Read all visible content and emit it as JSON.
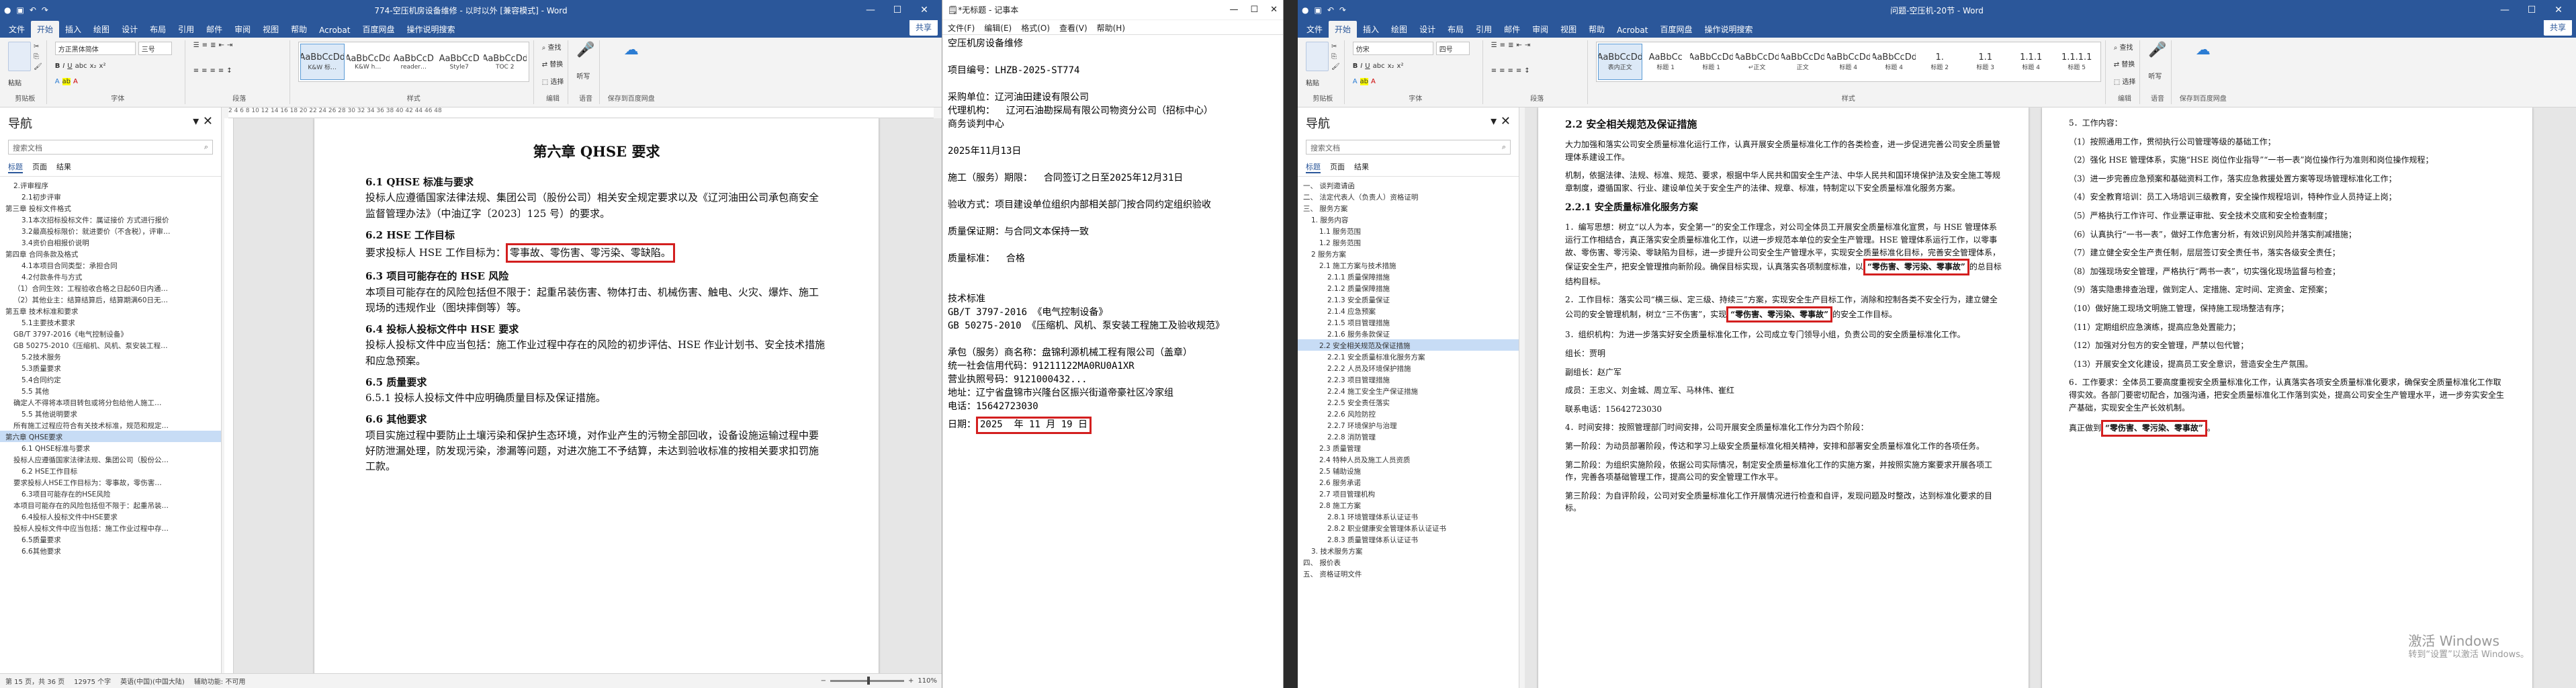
{
  "left": {
    "title": "774-空压机房设备维修 - 以时以外 [兼容模式] - Word",
    "tabs": [
      "文件",
      "开始",
      "插入",
      "绘图",
      "设计",
      "布局",
      "引用",
      "邮件",
      "审阅",
      "视图",
      "帮助",
      "Acrobat",
      "百度网盘",
      "操作说明搜索"
    ],
    "share": "共享",
    "font_name": "方正黑体简体",
    "font_size": "三号",
    "groups": [
      "剪贴板",
      "字体",
      "段落",
      "样式",
      "编辑",
      "语音",
      "保存到百度网盘"
    ],
    "paste": "粘贴",
    "styles": [
      {
        "sample": "AaBbCcDd",
        "name": "K&W 标…"
      },
      {
        "sample": "AaBbCcDd",
        "name": "K&W h…"
      },
      {
        "sample": "AaBbCcD",
        "name": "reader…"
      },
      {
        "sample": "AaBbCcD",
        "name": "Style7"
      },
      {
        "sample": "AaBbCcDd",
        "name": "TOC 2"
      }
    ],
    "edit": [
      "查找",
      "替换",
      "选择"
    ],
    "voice": "听写",
    "nav_title": "导航",
    "nav_search": "搜索文档",
    "nav_tabs": [
      "标题",
      "页面",
      "结果"
    ],
    "nav_items": [
      "2.评审程序",
      "2.1初步评审",
      "第三章 投标文件格式",
      "3.1本次招标投标文件：属证接价 方式进行报价",
      "3.2最高投标限价：就进要价（不含税），评审…",
      "3.4资价自相报价说明",
      "第四章 合同条款及格式",
      "4.1本项目合同类型：承担合同",
      "4.2付款条件与方式",
      "（1）合同生效：工程验收合格之日起60日内通…",
      "（2）其他业主：结算结算后，结算期满60日无…",
      "第五章 技术标准和要求",
      "5.1主要技术要求",
      "GB/T 3797-2016《电气控制设备》",
      "GB 50275-2010《压缩机、风机、泵安装工程…",
      "5.2技术服务",
      "5.3质量要求",
      "5.4合同约定",
      "5.5 其他",
      "确定人不得将本项目转包或将分包给他人施工…",
      "5.5 其他说明要求",
      "所有施工过程应符合有关技术标准，规范和规定…",
      "第六章 QHSE要求",
      "6.1 QHSE标准与要求",
      "投标人应遵循国家法律法规、集团公司（股份公…",
      "6.2 HSE工作目标",
      "要求投标人HSE工作目标为：零事故，零伤害…",
      "6.3项目可能存在的HSE风险",
      "本项目可能存在的风险包括但不限于：起重吊装…",
      "6.4投标人投标文件中HSE要求",
      "投标人投标文件中应当包括：施工作业过程中存…",
      "6.5质量要求",
      "6.6其他要求"
    ],
    "nav_active_index": 22,
    "ruler": "2  4  6  8  10  12  14  16  18  20  22  24  26  28  30  32  34  36  38  40  42  44  46  48",
    "doc": {
      "title": "第六章 QHSE 要求",
      "s1_head": "6.1 QHSE 标准与要求",
      "s1_body": "投标人应遵循国家法律法规、集团公司（股份公司）相关安全规定要求以及《辽河油田公司承包商安全监督管理办法》（中油辽字〔2023〕125 号）的要求。",
      "s2_head": "6.2 HSE 工作目标",
      "s2_body_pre": "要求投标人 HSE 工作目标为：",
      "s2_body_box": "零事故、零伤害、零污染、零缺陷。",
      "s3_head": "6.3 项目可能存在的 HSE 风险",
      "s3_body": "本项目可能存在的风险包括但不限于：起重吊装伤害、物体打击、机械伤害、触电、火灾、爆炸、施工现场的违规作业（图块摔倒等）等。",
      "s4_head": "6.4 投标人投标文件中 HSE 要求",
      "s4_body": "投标人投标文件中应当包括：施工作业过程中存在的风险的初步评估、HSE 作业计划书、安全技术措施和应急预案。",
      "s5_head": "6.5 质量要求",
      "s5_body": "6.5.1 投标人投标文件中应明确质量目标及保证措施。",
      "s6_head": "6.6 其他要求",
      "s6_body": "项目实施过程中要防止土壤污染和保护生态环境，对作业产生的污物全部回收，设备设施运输过程中要好防泄漏处理，防发现污染，渗漏等问题，对进次施工不予结算，未达到验收标准的按相关要求扣罚施工款。"
    },
    "status": [
      "第 15 页，共 36 页",
      "12975 个字",
      "英语(中国)(中国大陆)",
      "辅助功能: 不可用"
    ],
    "zoom": "110%"
  },
  "mid": {
    "title": "*无标题 - 记事本",
    "menu": [
      "文件(F)",
      "编辑(E)",
      "格式(O)",
      "查看(V)",
      "帮助(H)"
    ],
    "lines": [
      "空压机房设备维修",
      "",
      "项目编号：LHZB-2025-ST774",
      "",
      "采购单位：辽河油田建设有限公司",
      "代理机构：  辽河石油勘探局有限公司物资分公司（招标中心）",
      "商务谈判中心",
      "",
      "2025年11月13日",
      "",
      "施工（服务）期限：  合同签订之日至2025年12月31日",
      "",
      "验收方式：项目建设单位组织内部相关部门按合同约定组织验收",
      "",
      "质量保证期：与合同文本保持一致",
      "",
      "质量标准：  合格",
      "",
      "",
      "技术标准",
      "GB/T 3797-2016 《电气控制设备》",
      "GB 50275-2010 《压缩机、风机、泵安装工程施工及验收规范》",
      "",
      "承包（服务）商名称：盘锦利源机械工程有限公司（盖章）",
      "统一社会信用代码：91211122MA0RU0A1XR",
      "营业执照号码：9121000432...",
      "地址：辽宁省盘锦市兴隆台区振兴街道帝豪社区冷家组",
      "电话：15642723030"
    ],
    "date_label": "日期：",
    "date_box": "2025  年 11 月 19 日"
  },
  "right": {
    "title": "问题-空压机-20节 - Word",
    "tabs": [
      "文件",
      "开始",
      "插入",
      "绘图",
      "设计",
      "布局",
      "引用",
      "邮件",
      "审阅",
      "视图",
      "帮助",
      "Acrobat",
      "百度网盘",
      "操作说明搜索"
    ],
    "share": "共享",
    "font_name": "仿宋",
    "font_size": "四号",
    "styles": [
      {
        "sample": "AaBbCcDd",
        "name": "表内正文"
      },
      {
        "sample": "AaBbCc",
        "name": "标题 1"
      },
      {
        "sample": "AaBbCcDd",
        "name": "标题 1"
      },
      {
        "sample": "AaBbCcDd",
        "name": "↵正文"
      },
      {
        "sample": "AaBbCcDd",
        "name": "正文"
      },
      {
        "sample": "AaBbCcDd",
        "name": "标题 4"
      },
      {
        "sample": "AaBbCcDd",
        "name": "标题 4"
      },
      {
        "sample": "1.",
        "name": "标题 2"
      },
      {
        "sample": "1.1",
        "name": "标题 3"
      },
      {
        "sample": "1.1.1",
        "name": "标题 4"
      },
      {
        "sample": "1.1.1.1",
        "name": "标题 5"
      }
    ],
    "groups": [
      "剪贴板",
      "字体",
      "段落",
      "样式",
      "编辑",
      "语音",
      "保存到百度网盘"
    ],
    "nav_title": "导航",
    "nav_search": "搜索文档",
    "nav_tabs": [
      "标题",
      "页面",
      "结果"
    ],
    "nav_items": [
      "一、 谈判邀请函",
      "二、 法定代表人（负责人）资格证明",
      "三、 服务方案",
      "1. 服务内容",
      "1.1 服务范围",
      "1.2 服务范围",
      "2 服务方案",
      "2.1 施工方案与技术措施",
      "2.1.1 质量保障措施",
      "2.1.2 质量保障措施",
      "2.1.3 安全质量保证",
      "2.1.4 应急预案",
      "2.1.5 项目管理措施",
      "2.1.6 服务条款保证",
      "2.2 安全相关规范及保证措施",
      "2.2.1 安全质量标准化服务方案",
      "2.2.2 人员及环境保护措施",
      "2.2.3 项目管理措施",
      "2.2.4 施工安全生产保证措施",
      "2.2.5 安全责任落实",
      "2.2.6 风险防控",
      "2.2.7 环境保护与治理",
      "2.2.8 消防管理",
      "2.3 质量管理",
      "2.4 特种人员及施工人员资质",
      "2.5 辅助设施",
      "2.6 服务承诺",
      "2.7 项目管理机构",
      "2.8 施工方案",
      "2.8.1 环境管理体系认证证书",
      "2.8.2 职业健康安全管理体系认证证书",
      "2.8.3 质量管理体系认证证书",
      "3. 技术服务方案",
      "四、 报价表",
      "五、 资格证明文件"
    ],
    "nav_active_index": 14,
    "page1": {
      "h1": "2.2  安全相关规范及保证措施",
      "p1": "大力加强和落实公司安全质量标准化运行工作，认真开展安全质量标准化工作的各类检查，进一步促进完善公司安全质量管理体系建设工作。",
      "p2": "机制，依据法律、法规、标准、规范、要求，根据中华人民共和国安全生产法、中华人民共和国环境保护法及安全施工等规章制度，遵循国家、行业、建设单位关于安全生产的法律、规章、标准，特制定以下安全质量标准化服务方案。",
      "h2": "2.2.1 安全质量标准化服务方案",
      "p3_pre": "1．编写思想：树立“以人为本，安全第一”的安全工作理念，对公司全体员工开展安全质量标准化宣贯，与 HSE 管理体系运行工作相结合，真正落实安全质量标准化工作，以进一步规范本单位的安全生产管理。HSE 管理体系运行工作，以零事故、零伤害、零污染、零缺陷为目标，进一步提升公司安全生产管理水平，实现安全质量标准化目标，完善安全管理体系，保证安全生产，把安全管理推向新阶段。确保目标实现，认真落实各项制度标准，以",
      "p3_box": "“零伤害、零污染、零事故”",
      "p3_post": "的总目标结构目标。",
      "p4_pre": "2．工作目标：落实公司“横三纵、定三级、持续三”方案，实现安全生产目标工作，消除和控制各类不安全行为，建立健全公司的安全管理机制，树立“三不伤害”，实现",
      "p4_box": "“零伤害、零污染、零事故”",
      "p4_post": "的安全工作目标。",
      "p5": "3．组织机构：为进一步落实好安全质量标准化工作，公司成立专门领导小组，负责公司的安全质量标准化工作。",
      "p6": "组长：贾明",
      "p7": "副组长：赵广军",
      "p8": "成员：王忠义、刘金城、周立军、马林伟、崔红",
      "p9": "联系电话：15642723030",
      "p10": "4．时间安排：按照管理部门时间安排，公司开展安全质量标准化工作分为四个阶段：",
      "p11": "第一阶段：为动员部署阶段，传达和学习上级安全质量标准化相关精神，安排和部署安全质量标准化工作的各项任务。",
      "p12": "第二阶段：为组织实施阶段，依据公司实际情况，制定安全质量标准化工作的实施方案，并按照实施方案要求开展各项工作，完善各项基础管理工作，提高公司的安全管理工作水平。",
      "p13": "第三阶段：为自评阶段，公司对安全质量标准化工作开展情况进行检查和自评，发现问题及时整改，达到标准化要求的目标。"
    },
    "page2": {
      "lines": [
        "5．工作内容：",
        "（1）按照通用工作，贯彻执行公司管理等级的基础工作；",
        "（2）强化 HSE 管理体系，实施“HSE 岗位作业指导”“一书一表”岗位操作行为准则和岗位操作规程；",
        "（3）进一步完善应急预案和基础资料工作，落实应急救援处置方案等现场管理标准化工作；",
        "（4）安全教育培训：员工入场培训三级教育，安全操作规程培训，特种作业人员持证上岗；",
        "（5）严格执行工作许可、作业票证审批、安全技术交底和安全检查制度；",
        "（6）认真执行“一书一表”，做好工作危害分析，有效识别风险并落实削减措施；",
        "（7）建立健全安全生产责任制，层层签订安全责任书，落实各级安全责任；",
        "（8）加强现场安全管理，严格执行“两书一表”，切实强化现场监督与检查；",
        "（9）落实隐患排查治理，做到定人、定措施、定时间、定资金、定预案；",
        "（10）做好施工现场文明施工管理，保持施工现场整洁有序；",
        "（11）定期组织应急演练，提高应急处置能力；",
        "（12）加强对分包方的安全管理，严禁以包代管；",
        "（13）开展安全文化建设，提高员工安全意识，营造安全生产氛围。",
        "6．工作要求：全体员工要高度重视安全质量标准化工作，认真落实各项安全质量标准化要求，确保安全质量标准化工作取得实效。各部门要密切配合，加强沟通，把安全质量标准化工作落到实处，提高公司安全生产管理水平，进一步夯实安全生产基础，实现安全生产长效机制。"
      ],
      "last_pre": "真正做到",
      "last_box": "“零伤害、零污染、零事故”",
      "last_post": "。"
    },
    "watermark": [
      "激活 Windows",
      "转到“设置”以激活 Windows。"
    ]
  }
}
